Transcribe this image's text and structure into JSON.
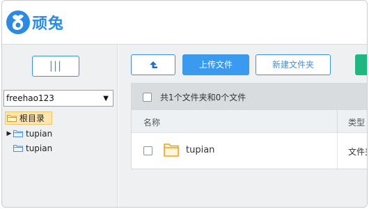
{
  "brand": {
    "name": "顽兔",
    "color": "#2b8ae6"
  },
  "sidebar": {
    "toggle_label": "|||",
    "user_select": {
      "value": "freehao123"
    },
    "tree": {
      "root_label": "根目录",
      "children": [
        {
          "label": "tupian",
          "has_children": true
        },
        {
          "label": "tupian",
          "has_children": false
        }
      ]
    }
  },
  "toolbar": {
    "up_icon": "arrow-up-return-icon",
    "upload_label": "上传文件",
    "new_folder_label": "新建文件夹",
    "colors": {
      "primary": "#3a9af0",
      "green": "#21b782"
    }
  },
  "file_list": {
    "summary": "共1个文件夹和0个文件",
    "columns": [
      "名称",
      "类型"
    ],
    "rows": [
      {
        "name": "tupian",
        "type": "文件夹",
        "icon": "folder-icon"
      }
    ]
  }
}
